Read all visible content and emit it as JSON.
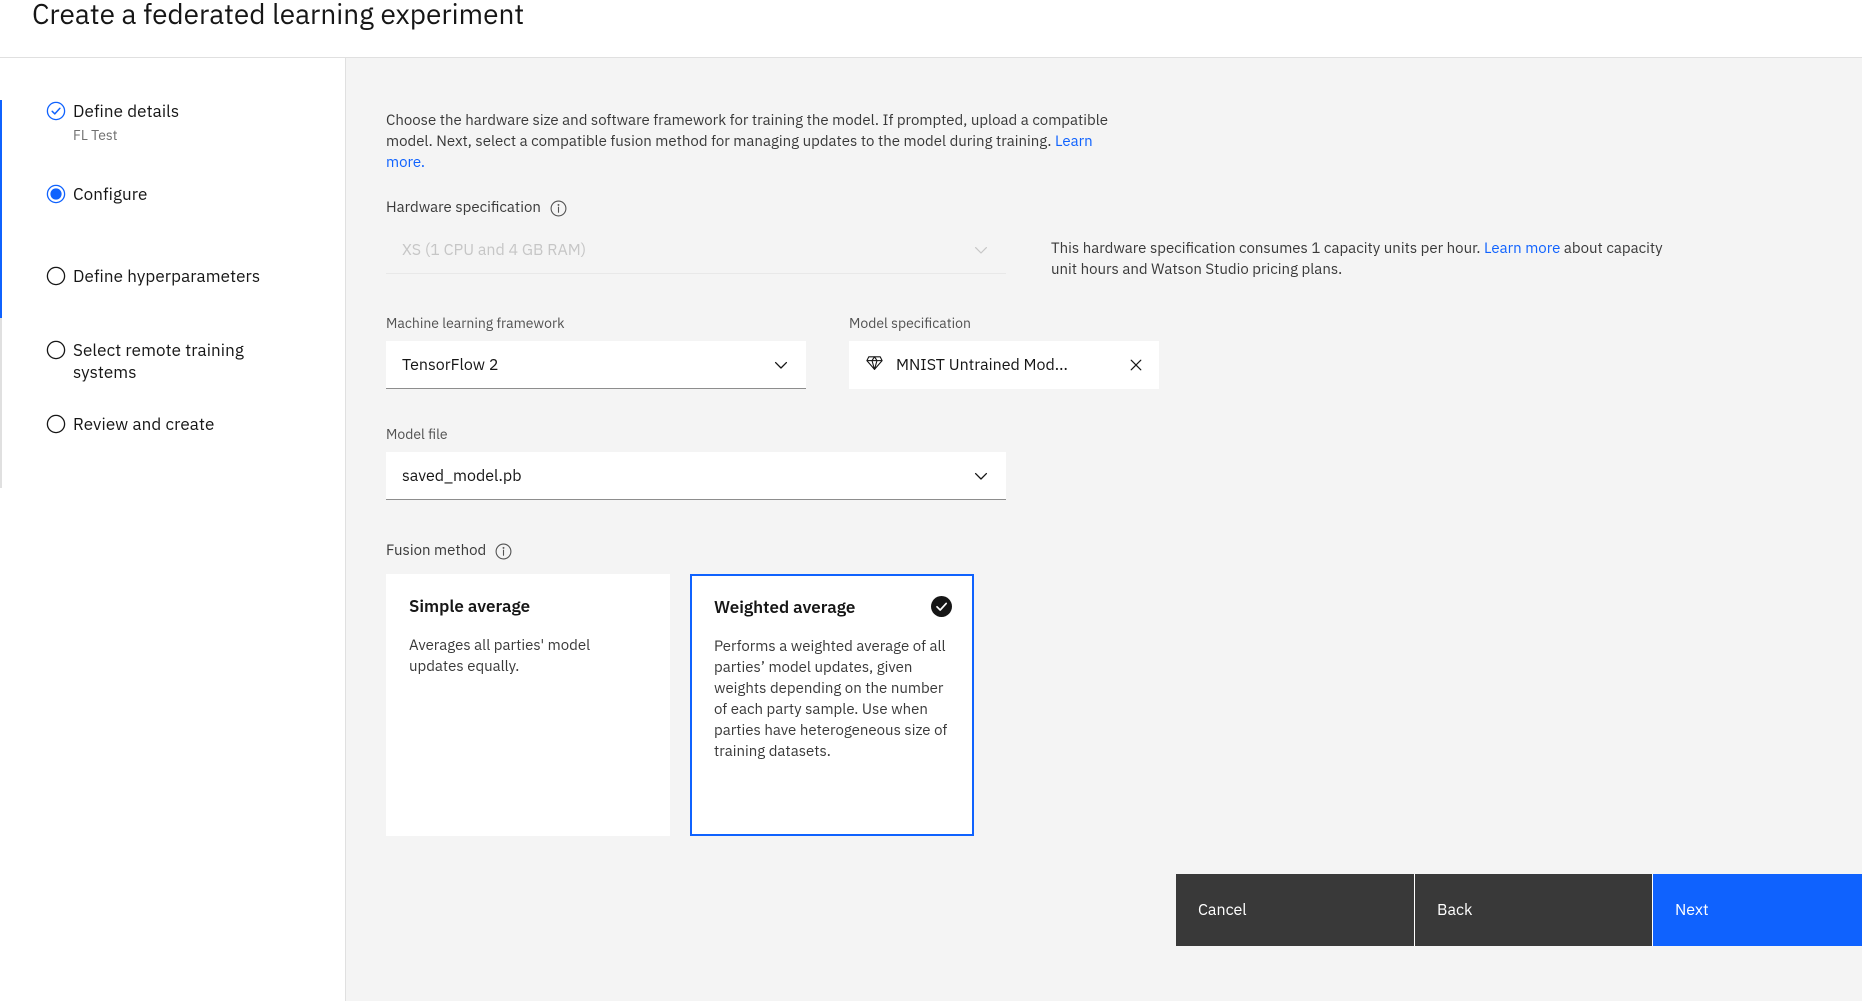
{
  "header": {
    "title": "Create a federated learning experiment"
  },
  "sidebar": {
    "steps": [
      {
        "label": "Define details",
        "sub": "FL Test",
        "state": "complete",
        "icon": "check-circle-icon"
      },
      {
        "label": "Configure",
        "sub": "",
        "state": "current",
        "icon": "radio-selected-icon"
      },
      {
        "label": "Define hyperparameters",
        "sub": "",
        "state": "incomplete",
        "icon": "radio-empty-icon"
      },
      {
        "label": "Select remote training systems",
        "sub": "",
        "state": "incomplete",
        "icon": "radio-empty-icon"
      },
      {
        "label": "Review and create",
        "sub": "",
        "state": "incomplete",
        "icon": "radio-empty-icon"
      }
    ]
  },
  "main": {
    "intro": {
      "text": "Choose the hardware size and software framework for training the model. If prompted, upload a compatible model. Next, select a compatible fusion method for managing updates to the model during training.",
      "link_label": "Learn more."
    },
    "hardware": {
      "label": "Hardware specification",
      "info_icon": "information-icon",
      "value": "XS (1 CPU and 4 GB RAM)",
      "disabled": true,
      "note_text_before": "This hardware specification consumes 1 capacity units per hour.",
      "note_link": "Learn more",
      "note_text_after": "about capacity unit hours and Watson Studio pricing plans."
    },
    "framework": {
      "label": "Machine learning framework",
      "value": "TensorFlow 2"
    },
    "model_spec": {
      "label": "Model specification",
      "value": "MNIST Untrained Mod...",
      "asset_icon": "model-asset-icon",
      "close_icon": "close-icon"
    },
    "model_file": {
      "label": "Model file",
      "value": "saved_model.pb"
    },
    "fusion": {
      "label": "Fusion method",
      "info_icon": "information-icon",
      "options": [
        {
          "title": "Simple average",
          "description": "Averages all parties' model updates equally.",
          "selected": false
        },
        {
          "title": "Weighted average",
          "description": "Performs a weighted average of all parties’ model updates, given weights depending on the number of each party sample. Use when parties have heterogeneous size of training datasets.",
          "selected": true
        }
      ]
    }
  },
  "footer": {
    "cancel_label": "Cancel",
    "back_label": "Back",
    "next_label": "Next"
  },
  "colors": {
    "accent": "#0f62fe",
    "panel_bg": "#f4f4f4",
    "button_dark": "#393939"
  }
}
